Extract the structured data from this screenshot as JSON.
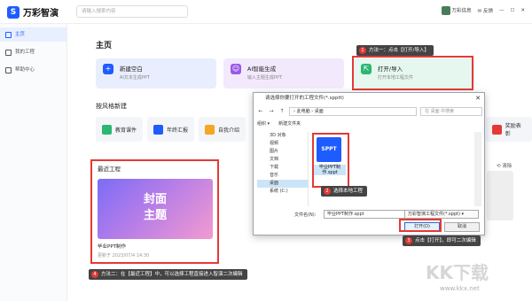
{
  "app": {
    "name": "万彩智演",
    "search_placeholder": "请输入搜索内容",
    "user": "万彩信息",
    "feedback": "反馈"
  },
  "sidebar": {
    "items": [
      {
        "label": "主页"
      },
      {
        "label": "我的工程"
      },
      {
        "label": "帮助中心"
      }
    ]
  },
  "main": {
    "title": "主页",
    "cards": [
      {
        "title": "新建空白",
        "desc": "AI文本生成PPT"
      },
      {
        "title": "AI智能生成",
        "desc": "输入主题生成PPT"
      },
      {
        "title": "打开/导入",
        "desc": "打开本地工程文件"
      }
    ],
    "style_section": "按风格新建",
    "styles": [
      {
        "label": "教育课件"
      },
      {
        "label": "年终汇报"
      },
      {
        "label": "自我介绍"
      },
      {
        "label": "奖励表彰"
      }
    ],
    "recent_title": "最近工程",
    "clear_label": "清除",
    "recent_project": {
      "thumb_line1": "封面",
      "thumb_line2": "主题",
      "name": "毕业PPT制作",
      "date": "更新于 2023/07/4 14:30"
    }
  },
  "dialog": {
    "title": "请选择你要打开的工程文件(*.spptt)",
    "path": "› 此电脑 › 桌面",
    "search_placeholder": "在 桌面 中搜索",
    "toolbar": [
      "组织 ▾",
      "新建文件夹"
    ],
    "tree": [
      "3D 对象",
      "视频",
      "图片",
      "文档",
      "下载",
      "音乐",
      "桌面",
      "系统 (C:)"
    ],
    "tree_selected_index": 6,
    "file": {
      "badge": "SPPT",
      "name": "毕业PPT制作.sppt"
    },
    "filename_label": "文件名(N):",
    "filename_value": "毕业PPT制作.sppt",
    "filetype": "万彩智演工程文件(*.sppt)",
    "open_button": "打开(O)",
    "cancel_button": "取消"
  },
  "callouts": [
    {
      "num": "1",
      "text": "方法一：点击【打开/导入】"
    },
    {
      "num": "2",
      "text": "选择本地工程"
    },
    {
      "num": "3",
      "text": "点击【打开】，即可二次编辑"
    },
    {
      "num": "4",
      "text": "方法二：在【最近工程】中，可以选择工程直接进入智演二次编辑"
    }
  ],
  "watermark": {
    "main": "KK下载",
    "url": "www.kkx.net"
  },
  "colors": {
    "accent": "#1f5cff",
    "highlight": "#e53935"
  }
}
